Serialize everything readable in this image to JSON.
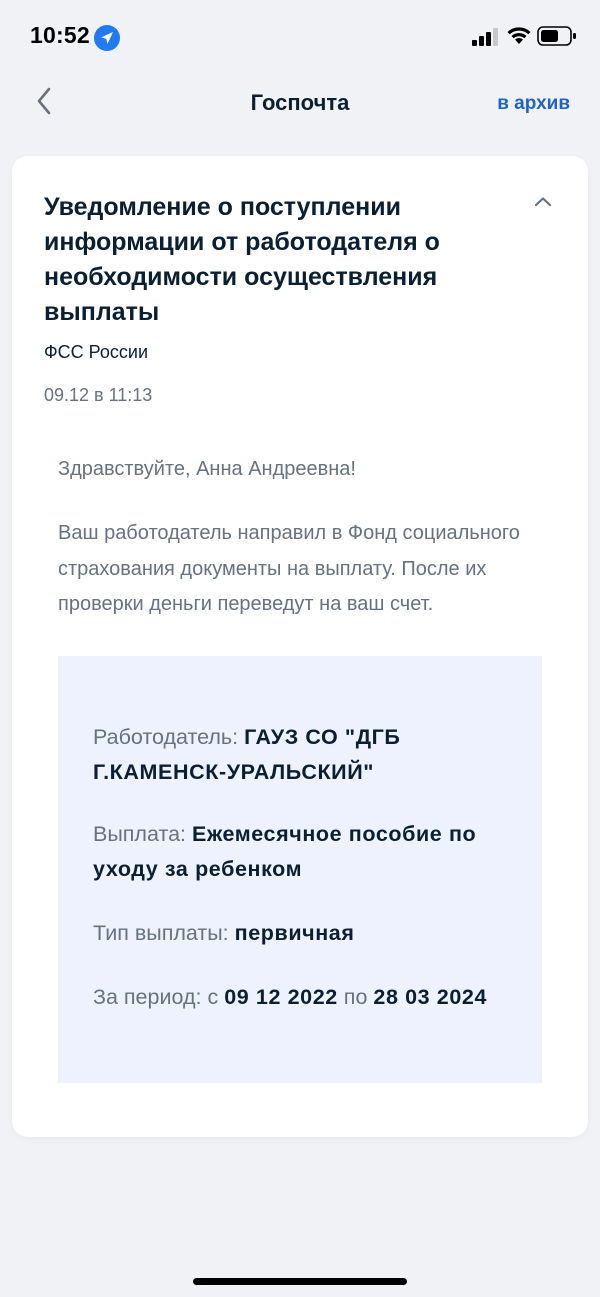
{
  "status_bar": {
    "time": "10:52"
  },
  "nav": {
    "title": "Госпочта",
    "archive_label": "в архив"
  },
  "message": {
    "title": "Уведомление о поступлении информации от работодателя о необходимости осуществления выплаты",
    "sender": "ФСС России",
    "date": "09.12 в 11:13",
    "greeting": "Здравствуйте, Анна Андреевна!",
    "body": "Ваш работодатель направил в Фонд социального страхования документы на выплату. После их проверки деньги переведут на ваш счет."
  },
  "details": {
    "employer_label": "Работодатель:",
    "employer_value": "ГАУЗ СО \"ДГБ Г.КАМЕНСК-УРАЛЬСКИЙ\"",
    "payment_label": "Выплата:",
    "payment_value": "Ежемесячное пособие по уходу за ребенком",
    "type_label": "Тип выплаты:",
    "type_value": "первичная",
    "period_label": "За период: с",
    "period_from": "09 12 2022",
    "period_to_label": "по",
    "period_to": "28 03 2024"
  },
  "colors": {
    "accent": "#1e63c8",
    "text_primary": "#0b1f33",
    "text_secondary": "#66727f",
    "details_bg": "#edf2fe",
    "page_bg": "#f1f2f5"
  },
  "icons": {
    "location": "location-arrow-icon",
    "back": "chevron-left-icon",
    "collapse": "chevron-up-icon",
    "signal": "cellular-signal-icon",
    "wifi": "wifi-icon",
    "battery": "battery-icon"
  }
}
